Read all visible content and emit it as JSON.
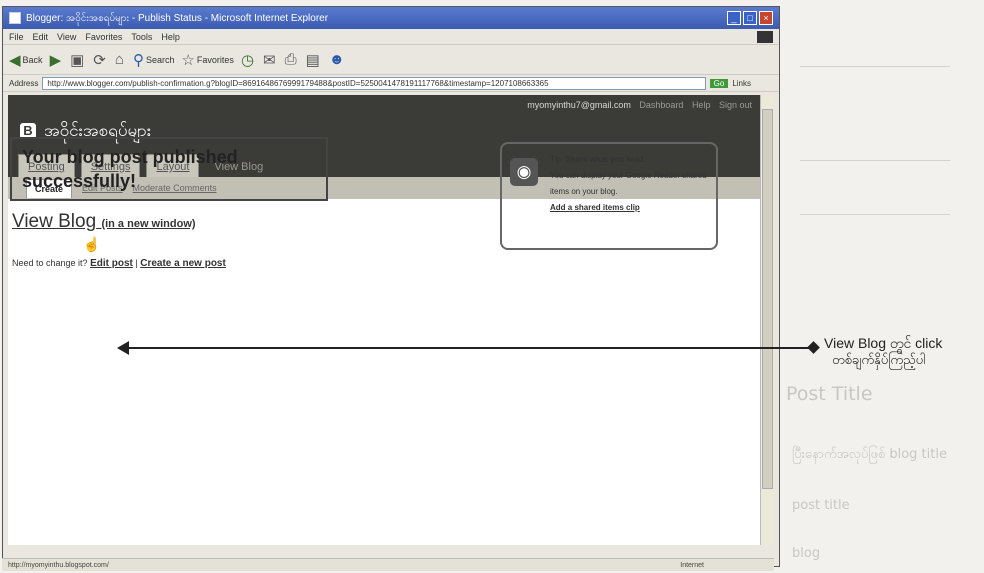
{
  "window": {
    "title": "Blogger: အဝိုင်းအစရပ်များ - Publish Status - Microsoft Internet Explorer",
    "minimize_glyph": "_",
    "maximize_glyph": "□",
    "close_glyph": "×"
  },
  "menu": [
    "File",
    "Edit",
    "View",
    "Favorites",
    "Tools",
    "Help"
  ],
  "toolbar": {
    "back_label": "Back",
    "search_label": "Search",
    "favorites_label": "Favorites"
  },
  "address": {
    "label": "Address",
    "url": "http://www.blogger.com/publish-confirmation.g?blogID=8691648676999179488&postID=5250041478191117768&timestamp=1207108663365",
    "go_label": "Go",
    "links_label": "Links"
  },
  "blogger": {
    "account_email": "myomyinthu7@gmail.com",
    "account_links": [
      "Dashboard",
      "Help",
      "Sign out"
    ],
    "logo_letter": "B",
    "blog_name": "အဝိုင်းအစရပ်များ",
    "tabs": [
      "Posting",
      "Settings",
      "Layout",
      "View Blog"
    ],
    "subtabs": [
      "Create",
      "Edit Posts",
      "Moderate Comments"
    ]
  },
  "main": {
    "published_message": "Your blog post published successfully!",
    "view_blog_label": "View Blog",
    "new_window_label": "(in a new window)",
    "change_prompt": "Need to change it?",
    "edit_post_label": "Edit post",
    "separator": "|",
    "create_post_label": "Create a new post"
  },
  "tip": {
    "prefix": "Tip:",
    "heading": "Share what you read.",
    "body": "You can display your Google Reader shared items on your blog.",
    "link": "Add a shared items clip"
  },
  "status": {
    "text": "http://myomyinthu.blogspot.com/",
    "zone": "Internet"
  },
  "callout": {
    "line1": "View Blog တွင် click",
    "line2": "တစ်ချက်နှိပ်ကြည့်ပါ"
  },
  "background_page": {
    "title": "Post Title",
    "line1": "ပြီးနောက်အလုပ်ဖြစ် blog title",
    "line2": "post title",
    "line3": "blog"
  }
}
